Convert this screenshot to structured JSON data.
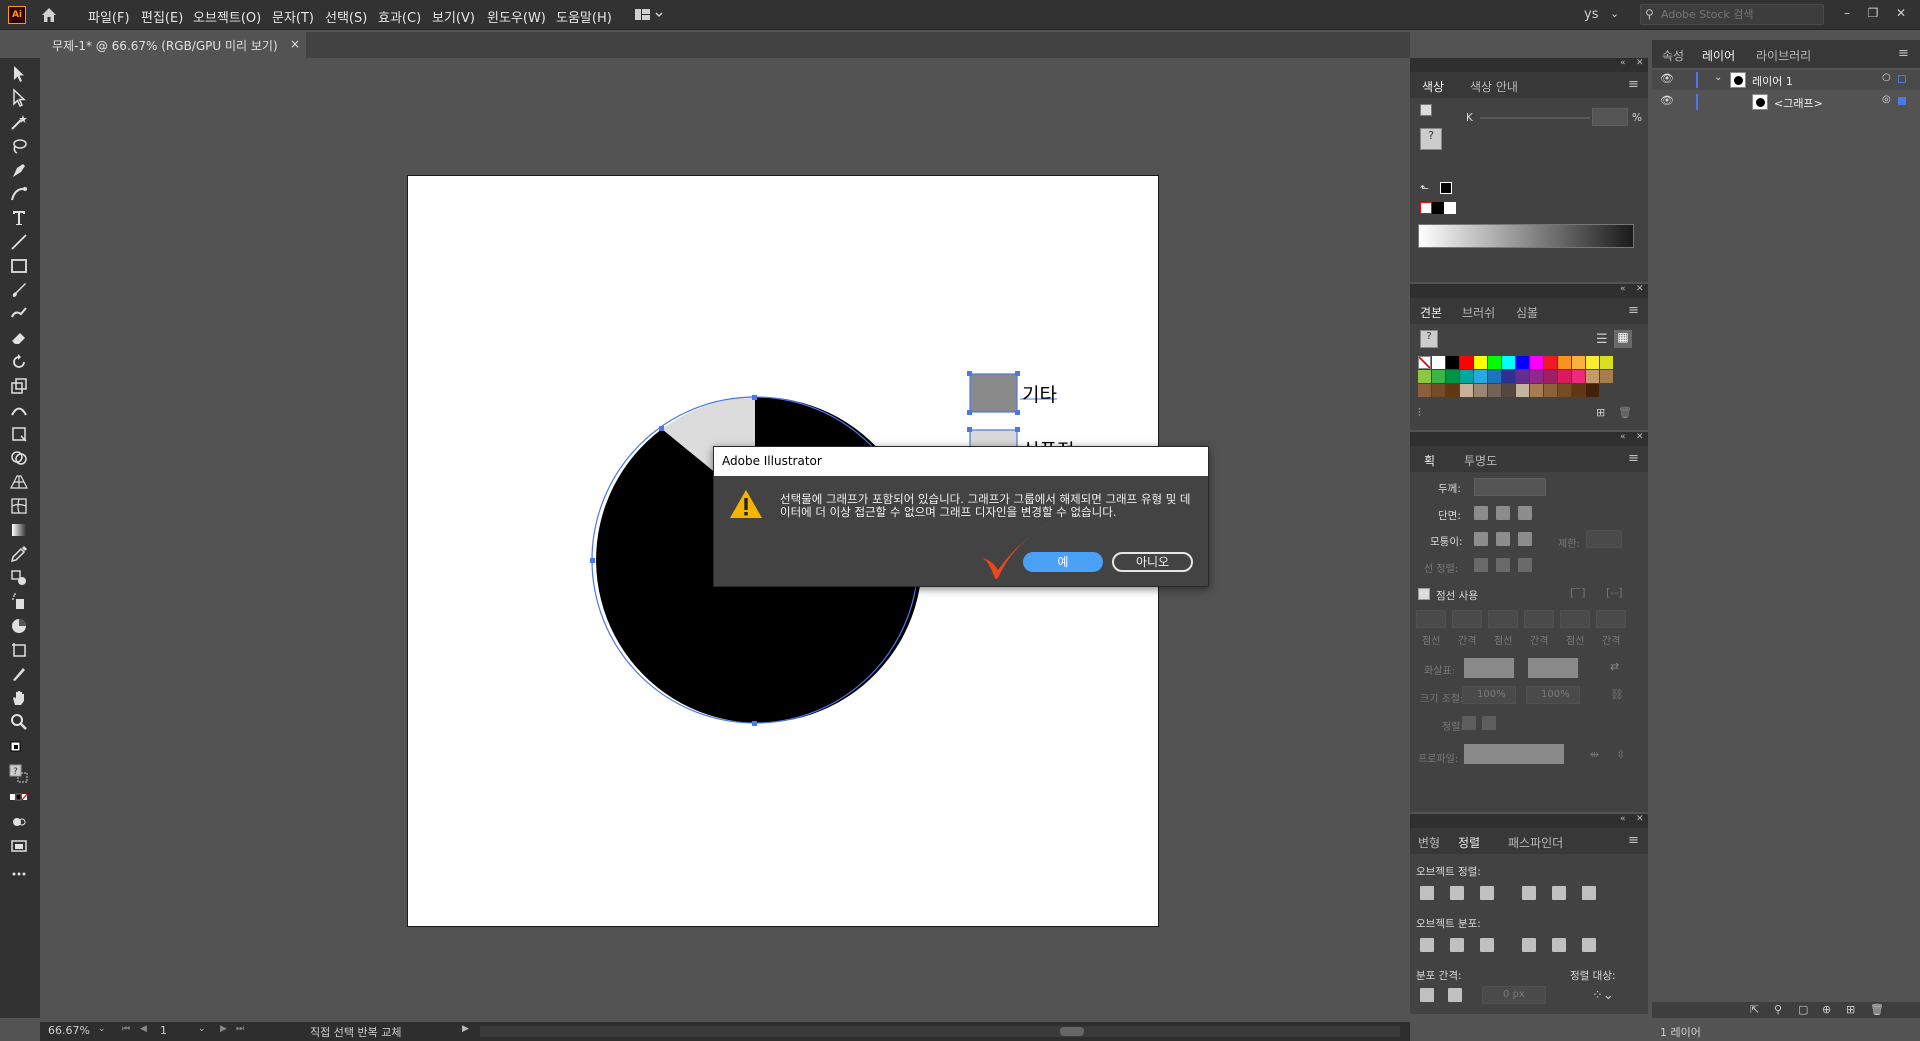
{
  "app": {
    "logo": "Ai",
    "menu": [
      "파일(F)",
      "편집(E)",
      "오브젝트(O)",
      "문자(T)",
      "선택(S)",
      "효과(C)",
      "보기(V)",
      "윈도우(W)",
      "도움말(H)"
    ],
    "user": "ys",
    "stock_search_placeholder": "Adobe Stock 검색"
  },
  "document": {
    "tab_label": "무제-1* @ 66.67% (RGB/GPU 미리 보기)",
    "close_glyph": "×"
  },
  "canvas": {
    "legend": [
      {
        "label": "기타",
        "color": "#8a8a8a"
      },
      {
        "label": "식품점",
        "color": "#d8d8d8"
      }
    ]
  },
  "dialog": {
    "title": "Adobe Illustrator",
    "message": "선택물에 그래프가 포함되어 있습니다. 그래프가 그룹에서 해제되면 그래프 유형 및 데이터에 더 이상 접근할 수 없으며 그래프 디자인을 변경할 수 없습니다.",
    "yes_label": "예",
    "no_label": "아니오"
  },
  "color_panel": {
    "tabs": [
      "색상",
      "색상 안내"
    ],
    "channel_label": "K",
    "percent": "%"
  },
  "swatches_panel": {
    "tabs": [
      "견본",
      "브러쉬",
      "심볼"
    ],
    "colors": [
      "#ffffff",
      "#000000",
      "#ff0000",
      "#ffff00",
      "#00ff00",
      "#00ffff",
      "#0000ff",
      "#ff00ff",
      "#ed1c24",
      "#f7931e",
      "#fbb040",
      "#f9ed32",
      "#d7df23",
      "#8dc63f",
      "#39b54a",
      "#009444",
      "#00a79d",
      "#27aae1",
      "#1c75bc",
      "#2e3192",
      "#662d91",
      "#92278f",
      "#9e1f63",
      "#da1c5c",
      "#ee2a7b",
      "#c49a6c",
      "#a97c50",
      "#8b5e3c",
      "#754c29",
      "#603913",
      "#c7b299",
      "#998675",
      "#736357",
      "#534741",
      "#c2b59b",
      "#a67c52",
      "#8c6239",
      "#754c24",
      "#603813",
      "#42210b"
    ]
  },
  "stroke_panel": {
    "tabs": [
      "획",
      "투명도"
    ],
    "weight_label": "두께:",
    "cap_label": "단면:",
    "corner_label": "모퉁이:",
    "limit_label": "제한:",
    "align_label": "선 정렬:",
    "dashed_label": "점선 사용",
    "dash_labels": [
      "점선",
      "간격",
      "점선",
      "간격",
      "점선",
      "간격"
    ],
    "arrow_label": "화살표:",
    "scale_label": "크기 조절:",
    "scale_values": [
      "100%",
      "100%"
    ],
    "align_arrow_label": "정렬:",
    "profile_label": "프로파일:"
  },
  "align_panel": {
    "tabs": [
      "변형",
      "정렬",
      "패스파인더"
    ],
    "object_align_label": "오브젝트 정렬:",
    "object_distribute_label": "오브젝트 분포:",
    "distribute_spacing_label": "분포 간격:",
    "spacing_value": "0 px",
    "align_to_label": "정렬 대상:"
  },
  "layers_panel": {
    "tabs": [
      "속성",
      "레이어",
      "라이브러리"
    ],
    "layers": [
      {
        "name": "레이어 1"
      },
      {
        "name": "<그래프>"
      }
    ],
    "count_label": "1 레이어"
  },
  "status": {
    "zoom": "66.67%",
    "page": "1",
    "tool_text": "직접 선택 반복 교체"
  },
  "annotation": {
    "checkmark_color": "#e8481c"
  }
}
